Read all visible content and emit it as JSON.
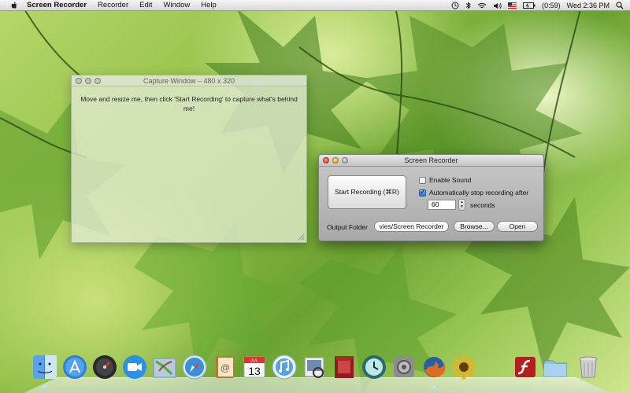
{
  "menubar": {
    "app_name": "Screen Recorder",
    "items": [
      "Recorder",
      "Edit",
      "Window",
      "Help"
    ],
    "battery_text": "(0:59)",
    "clock": "Wed 2:36 PM"
  },
  "capture_window": {
    "title": "Capture Window – 480 x 320",
    "instructions": "Move and resize me, then click 'Start Recording' to capture what's behind me!"
  },
  "recorder": {
    "title": "Screen Recorder",
    "start_button": "Start Recording (⌘R)",
    "enable_sound": {
      "label": "Enable Sound",
      "checked": false
    },
    "auto_stop": {
      "label": "Automatically stop recording after",
      "checked": true
    },
    "seconds_value": "60",
    "seconds_label": "seconds",
    "output_label": "Output Folder",
    "output_path": "vies/Screen Recorder",
    "browse_button": "Browse...",
    "open_button": "Open"
  },
  "dock": {
    "items": [
      {
        "name": "finder",
        "color": "#3f8fe0"
      },
      {
        "name": "app-store",
        "color": "#2f7fd8"
      },
      {
        "name": "dashboard",
        "color": "#1d1d1d"
      },
      {
        "name": "facetime",
        "color": "#2e8fe6"
      },
      {
        "name": "mail",
        "color": "#6a93c9"
      },
      {
        "name": "safari",
        "color": "#3a8fd9"
      },
      {
        "name": "address-book",
        "color": "#b07a3a"
      },
      {
        "name": "ical",
        "color": "#d9d9d9"
      },
      {
        "name": "itunes",
        "color": "#5aa0e0"
      },
      {
        "name": "preview",
        "color": "#6f8bb0"
      },
      {
        "name": "photo-booth",
        "color": "#8a1d1d"
      },
      {
        "name": "time-machine",
        "color": "#3c8a8f"
      },
      {
        "name": "system-preferences",
        "color": "#8d8d8d"
      },
      {
        "name": "firefox",
        "color": "#e06a1d"
      },
      {
        "name": "sunflower",
        "color": "#e8b21e"
      },
      {
        "name": "flash-player",
        "color": "#b81e1e"
      },
      {
        "name": "documents-folder",
        "color": "#8fc2e8"
      },
      {
        "name": "trash",
        "color": "#bfbfbf"
      }
    ],
    "ical_date": "13",
    "ical_month": "JUL"
  }
}
